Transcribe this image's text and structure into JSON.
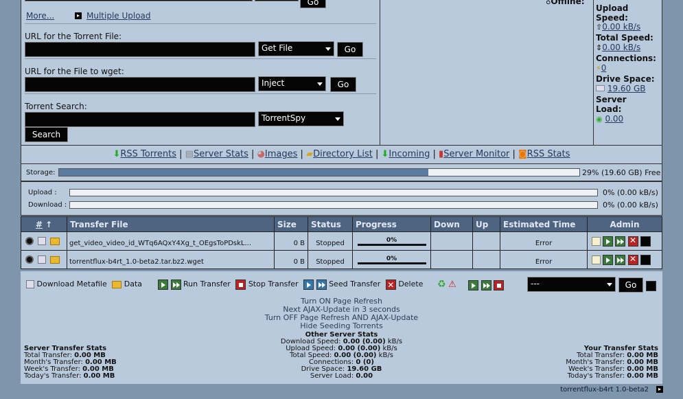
{
  "top_form": {
    "more_link": "More...",
    "multiple_upload": "Multiple Upload",
    "go_label": "Go",
    "torrent_url_label": "URL for the Torrent File:",
    "torrent_url_value": "",
    "get_file_select": "Get File",
    "wget_label": "URL for the File to wget:",
    "wget_value": "",
    "inject_select": "Inject",
    "search_label": "Torrent Search:",
    "search_value": "",
    "engine_select": "TorrentSpy",
    "search_button": "Search"
  },
  "status_sidebar": {
    "online_label": "Offline:",
    "upload_speed_label": "Upload Speed:",
    "upload_speed_value": "0.00 kB/s",
    "total_speed_label": "Total Speed:",
    "total_speed_value": "0.00 kB/s",
    "connections_label": "Connections:",
    "connections_value": "0",
    "drive_space_label": "Drive Space:",
    "drive_space_value": "19.60 GB",
    "server_load_label": "Server Load:",
    "server_load_value": "0.00"
  },
  "nav_links": [
    "RSS Torrents",
    "Server Stats",
    "Images",
    "Directory List",
    "Incoming",
    "Server Monitor",
    "RSS Stats"
  ],
  "storage": {
    "label": "Storage:",
    "fraction": 0.71,
    "text": "29% (19.60 GB) Free"
  },
  "transfer_bars": {
    "upload_label": "Upload :",
    "upload_text": "0% (0.00 kB/s)",
    "download_label": "Download :",
    "download_text": "0% (0.00 kB/s)"
  },
  "table": {
    "headers": {
      "num": "#",
      "sort": "↑",
      "file": "Transfer File",
      "size": "Size",
      "status": "Status",
      "progress": "Progress",
      "down": "Down",
      "up": "Up",
      "eta": "Estimated Time",
      "admin": "Admin"
    },
    "rows": [
      {
        "file": "get_video_video_id_WTq6AQxY4Xg_t_OEgsToPDskL...",
        "size": "0 B",
        "status": "Stopped",
        "progress": "0%",
        "down": "",
        "up": "",
        "eta": "Error"
      },
      {
        "file": "torrentflux-b4rt_1.0-beta2.tar.bz2.wget",
        "size": "0 B",
        "status": "Stopped",
        "progress": "0%",
        "down": "",
        "up": "",
        "eta": "Error"
      }
    ]
  },
  "legend": {
    "download_metafile": "Download Metafile",
    "data": "Data",
    "run_transfer": "Run Transfer",
    "stop_transfer": "Stop Transfer",
    "seed_transfer": "Seed Transfer",
    "delete": "Delete",
    "bulk_select": "---",
    "go": "Go"
  },
  "refresh": {
    "turn_on": "Turn ON Page Refresh",
    "next_ajax": "Next AJAX-Update in 3 seconds",
    "turn_off": "Turn OFF Page Refresh AND AJAX-Update",
    "hide_seeding": "Hide Seeding Torrents"
  },
  "server_stats": {
    "title": "Server Transfer Stats",
    "lines": [
      "Total Transfer:",
      "Month's Transfer:",
      "Week's Transfer:",
      "Today's Transfer:"
    ],
    "values": [
      "0.00 MB",
      "0.00 MB",
      "0.00 MB",
      "0.00 MB"
    ]
  },
  "other_stats": {
    "title": "Other Server Stats",
    "download_speed_label": "Download Speed:",
    "download_speed": "0.00 (0.00)",
    "download_unit": "kB/s",
    "upload_speed_label": "Upload Speed:",
    "upload_speed": "0.00 (0.00)",
    "upload_unit": "kB/s",
    "total_speed_label": "Total Speed:",
    "total_speed": "0.00 (0.00)",
    "total_unit": "kB/s",
    "connections_label": "Connections:",
    "connections": "0 (0)",
    "drive_space_label": "Drive Space:",
    "drive_space": "19.60 GB",
    "server_load_label": "Server Load:",
    "server_load": "0.00"
  },
  "your_stats": {
    "title": "Your Transfer Stats",
    "lines": [
      "Total Transfer:",
      "Month's Transfer:",
      "Week's Transfer:",
      "Today's Transfer:"
    ],
    "values": [
      "0.00 MB",
      "0.00 MB",
      "0.00 MB",
      "0.00 MB"
    ]
  },
  "footer": {
    "version": "torrentflux-b4rt 1.0-beta2"
  }
}
